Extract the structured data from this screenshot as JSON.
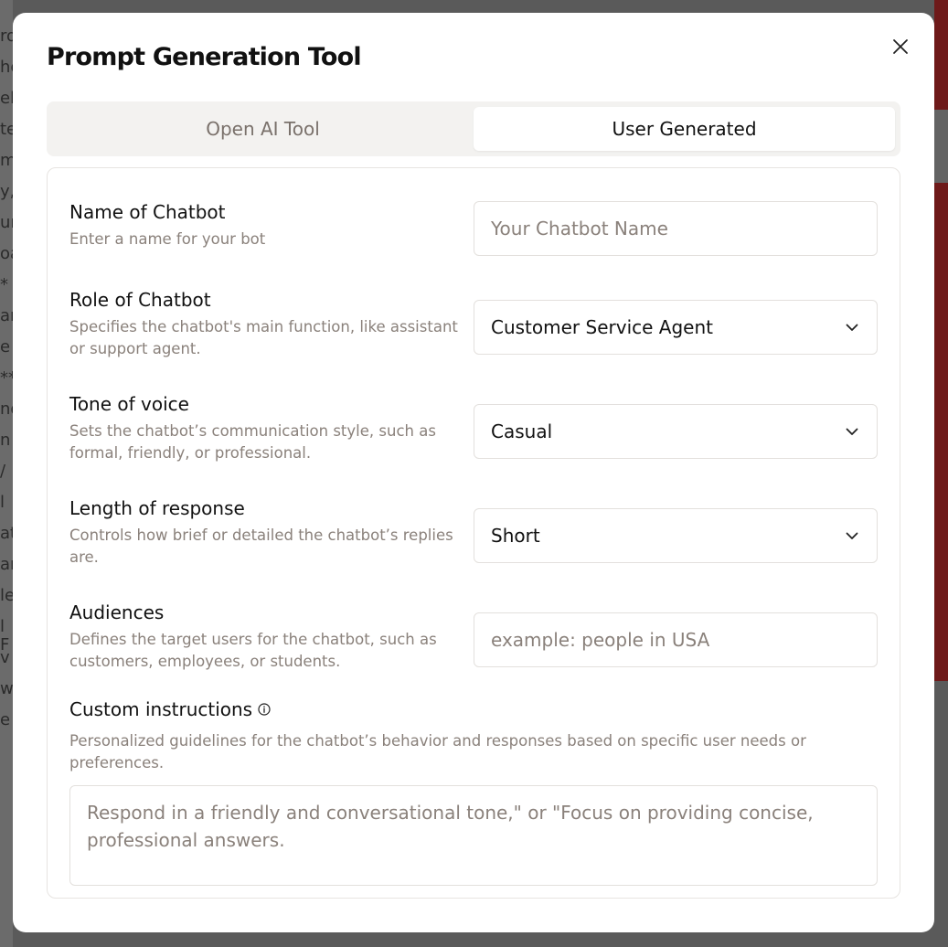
{
  "modal": {
    "title": "Prompt Generation Tool",
    "close_icon": "close-icon"
  },
  "tabs": [
    {
      "label": "Open AI Tool",
      "active": false
    },
    {
      "label": "User Generated",
      "active": true
    }
  ],
  "form": {
    "name": {
      "label": "Name of Chatbot",
      "description": "Enter a name for your bot",
      "placeholder": "Your Chatbot Name",
      "value": ""
    },
    "role": {
      "label": "Role of Chatbot",
      "description": "Specifies the chatbot's main function, like assistant or support agent.",
      "selected": "Customer Service Agent"
    },
    "tone": {
      "label": "Tone of voice",
      "description": "Sets the chatbot’s communication style, such as formal, friendly, or professional.",
      "selected": "Casual"
    },
    "length": {
      "label": "Length of response",
      "description": "Controls how brief or detailed the chatbot’s replies are.",
      "selected": "Short"
    },
    "audiences": {
      "label": "Audiences",
      "description": "Defines the target users for the chatbot, such as customers, employees, or students.",
      "placeholder": "example: people in USA",
      "value": ""
    },
    "custom": {
      "label": "Custom instructions",
      "description": "Personalized guidelines for the chatbot’s behavior and responses based on specific user needs or preferences.",
      "placeholder": "Respond in a friendly and conversational tone,\" or \"Focus on providing concise, professional answers.",
      "value": "",
      "info_icon": "info-icon"
    }
  },
  "colors": {
    "text_primary": "#111111",
    "text_muted": "#8a817b",
    "tab_bg": "#f3f2f0",
    "border": "#e3e0dd"
  },
  "background": {
    "left_snippets": [
      "ro",
      "he",
      "eh",
      "te",
      "m",
      "y,",
      "ur",
      "oa",
      "*",
      "ar",
      "e",
      "**",
      "no",
      "n",
      "/",
      "l",
      "at",
      "ar",
      "le",
      "l F",
      "v",
      "w",
      "e"
    ]
  }
}
